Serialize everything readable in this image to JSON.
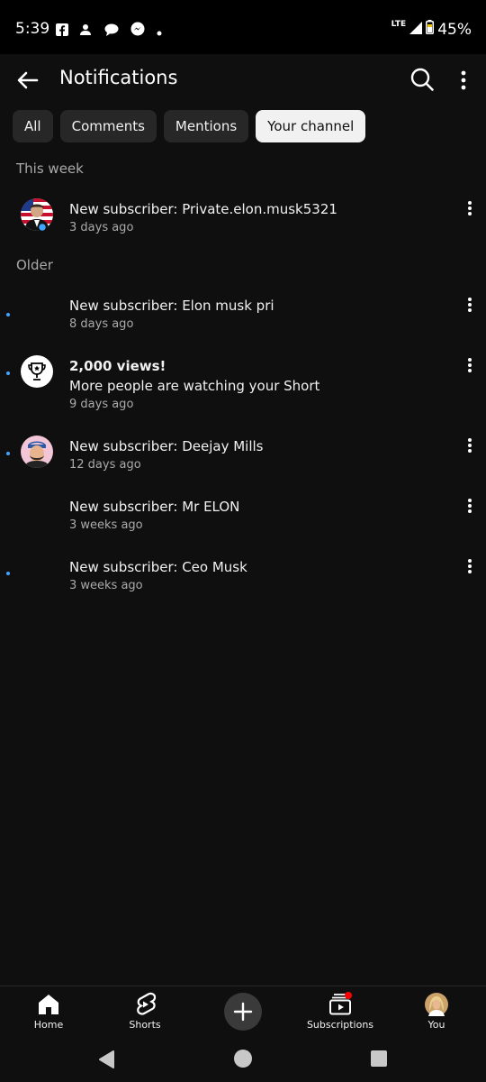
{
  "status_bar": {
    "time": "5:39",
    "network": "LTE",
    "battery": "45%",
    "icons": [
      "facebook-icon",
      "person-notification-icon",
      "chat-icon",
      "messenger-icon",
      "dot-icon"
    ]
  },
  "header": {
    "title": "Notifications",
    "back_icon": "arrow-left-icon",
    "search_icon": "search-icon",
    "more_icon": "more-vert-icon"
  },
  "chips": [
    {
      "label": "All",
      "active": false
    },
    {
      "label": "Comments",
      "active": false
    },
    {
      "label": "Mentions",
      "active": false
    },
    {
      "label": "Your channel",
      "active": true
    }
  ],
  "sections": {
    "this_week": "This week",
    "older": "Older"
  },
  "notifications": [
    {
      "title": "New subscriber: Private.elon.musk5321",
      "meta": "3 days ago",
      "unread": false,
      "avatar": "photo"
    },
    {
      "title": "New subscriber: Elon musk pri",
      "meta": "8 days ago",
      "unread": true,
      "avatar": "none"
    },
    {
      "title": "2,000 views!",
      "subtitle": "More people are watching your Short",
      "meta": "9 days ago",
      "unread": true,
      "avatar": "trophy-icon"
    },
    {
      "title": "New subscriber: Deejay Mills",
      "meta": "12 days ago",
      "unread": true,
      "avatar": "photo"
    },
    {
      "title": "New subscriber: Mr ELON",
      "meta": "3 weeks ago",
      "unread": false,
      "avatar": "none"
    },
    {
      "title": "New subscriber: Ceo Musk",
      "meta": "3 weeks ago",
      "unread": true,
      "avatar": "none"
    }
  ],
  "bottom_nav": [
    {
      "label": "Home",
      "icon": "home-icon"
    },
    {
      "label": "Shorts",
      "icon": "shorts-icon"
    },
    {
      "label": "Subscriptions",
      "icon": "subscriptions-icon"
    },
    {
      "label": "You",
      "icon": "profile-avatar"
    }
  ],
  "colors": {
    "background": "#0f0f0f",
    "chip": "#272727",
    "chip_active": "#f1f1f1",
    "unread_dot": "#3ea6ff",
    "badge": "#ff0000"
  }
}
